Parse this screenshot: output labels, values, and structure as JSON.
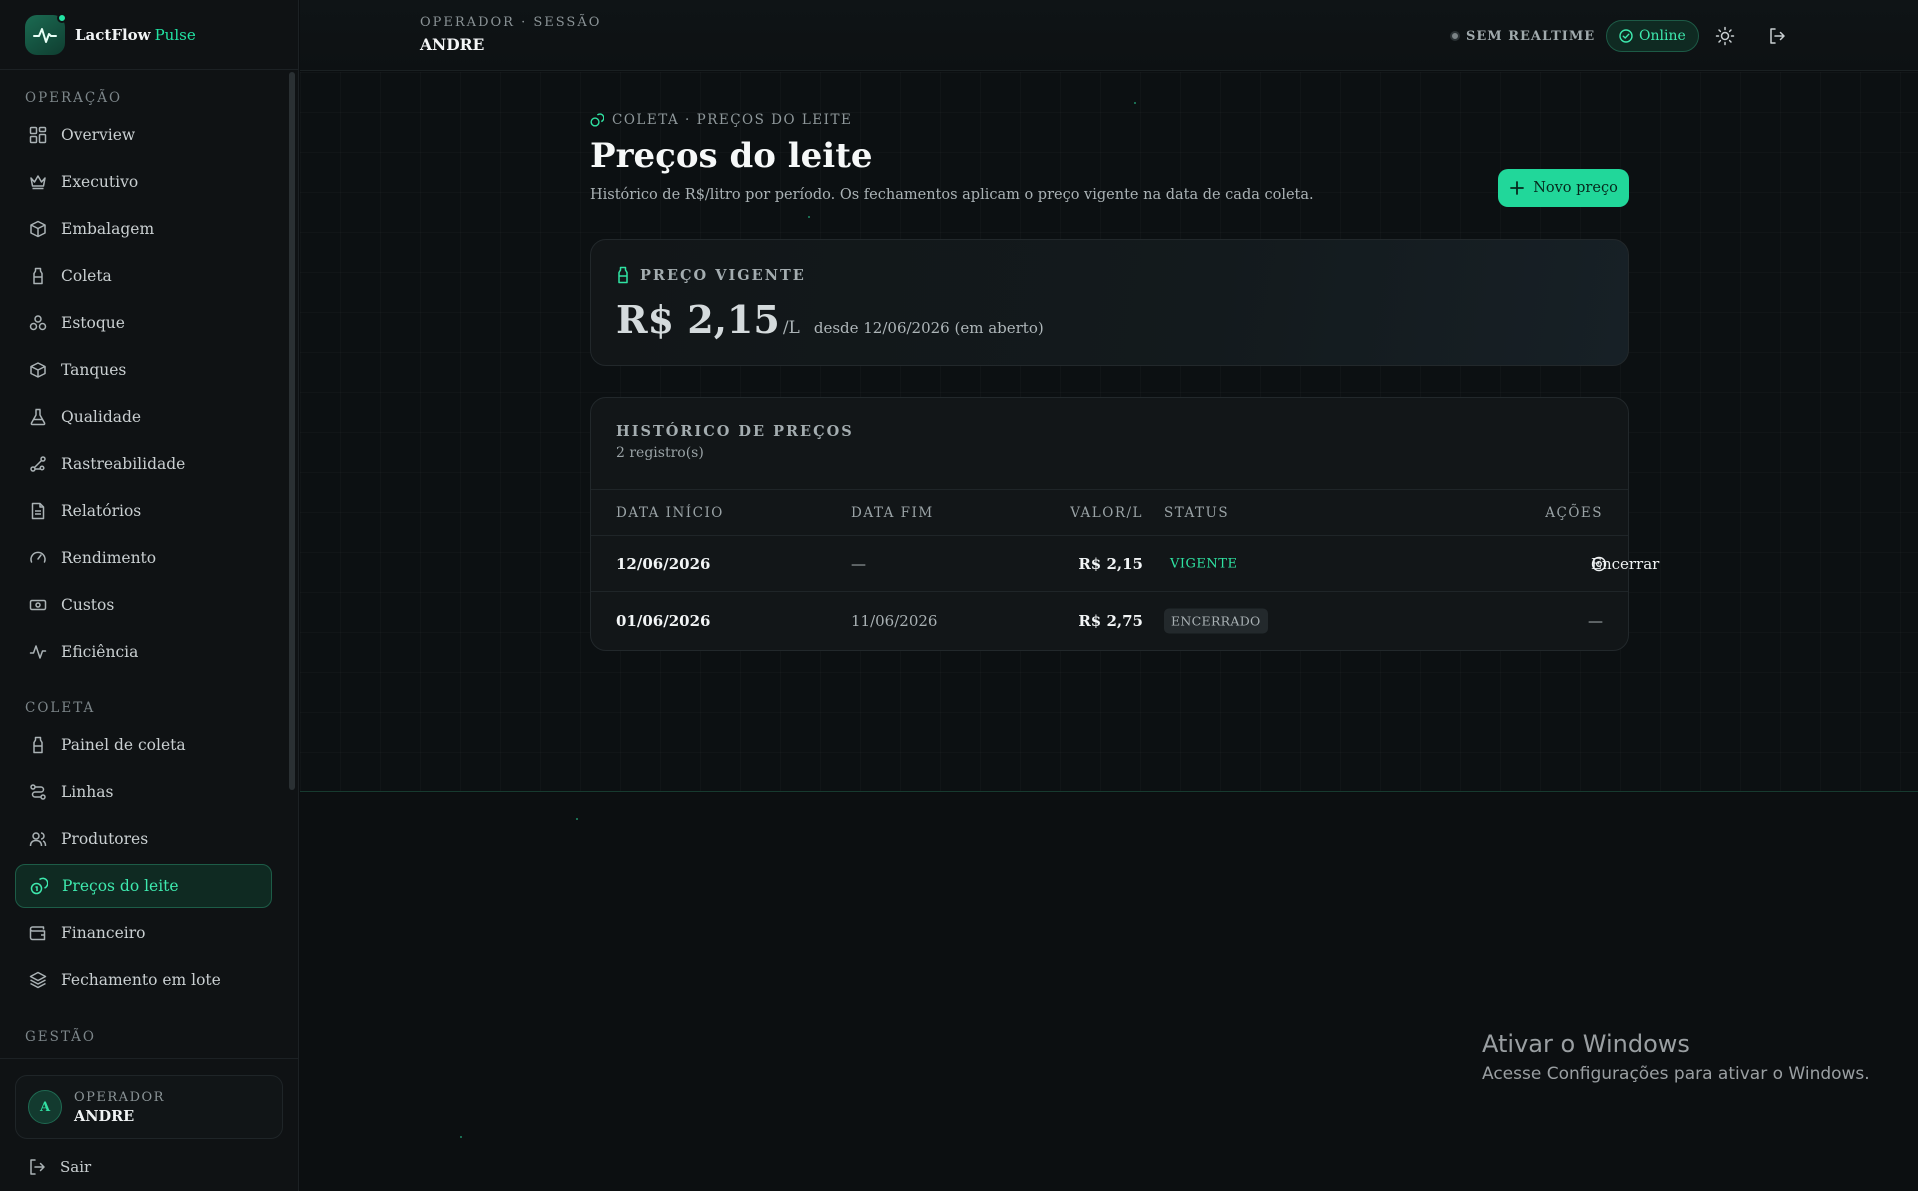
{
  "brand": {
    "name": "LactFlow",
    "accent": "Pulse"
  },
  "sidebar": {
    "sections": [
      {
        "label": "OPERAÇÃO"
      },
      {
        "label": "COLETA"
      },
      {
        "label": "GESTÃO"
      }
    ],
    "operacao": [
      {
        "label": "Overview",
        "icon": "grid-icon"
      },
      {
        "label": "Executivo",
        "icon": "crown-icon"
      },
      {
        "label": "Embalagem",
        "icon": "package-icon"
      },
      {
        "label": "Coleta",
        "icon": "milk-bottle-icon"
      },
      {
        "label": "Estoque",
        "icon": "boxes-icon"
      },
      {
        "label": "Tanques",
        "icon": "cube-icon"
      },
      {
        "label": "Qualidade",
        "icon": "flask-icon"
      },
      {
        "label": "Rastreabilidade",
        "icon": "route-icon"
      },
      {
        "label": "Relatórios",
        "icon": "document-icon"
      },
      {
        "label": "Rendimento",
        "icon": "gauge-icon"
      },
      {
        "label": "Custos",
        "icon": "banknote-icon"
      },
      {
        "label": "Eficiência",
        "icon": "activity-icon"
      }
    ],
    "coleta": [
      {
        "label": "Painel de coleta",
        "icon": "milk-bottle-icon"
      },
      {
        "label": "Linhas",
        "icon": "route-lines-icon"
      },
      {
        "label": "Produtores",
        "icon": "users-icon"
      },
      {
        "label": "Preços do leite",
        "icon": "coins-icon",
        "active": true
      },
      {
        "label": "Financeiro",
        "icon": "wallet-icon"
      },
      {
        "label": "Fechamento em lote",
        "icon": "layers-icon"
      }
    ],
    "user": {
      "initial": "A",
      "role": "OPERADOR",
      "name": "ANDRE"
    },
    "logout_label": "Sair"
  },
  "topbar": {
    "session_label": "OPERADOR · SESSÃO",
    "session_user": "ANDRE",
    "realtime_label": "SEM REALTIME",
    "online_label": "Online"
  },
  "page": {
    "breadcrumb": "COLETA · PREÇOS DO LEITE",
    "title": "Preços do leite",
    "subtitle": "Histórico de R$/litro por período. Os fechamentos aplicam o preço vigente na data de cada coleta.",
    "new_button": "Novo preço"
  },
  "current_price": {
    "label": "PREÇO VIGENTE",
    "value": "R$ 2,15",
    "unit": "/L",
    "since": "desde 12/06/2026 (em aberto)"
  },
  "history": {
    "title": "HISTÓRICO DE PREÇOS",
    "count": "2 registro(s)",
    "columns": [
      "DATA INÍCIO",
      "DATA FIM",
      "VALOR/L",
      "STATUS",
      "AÇÕES"
    ],
    "rows": [
      {
        "start": "12/06/2026",
        "end": "—",
        "value": "R$ 2,15",
        "status": "VIGENTE",
        "action": "Encerrar"
      },
      {
        "start": "01/06/2026",
        "end": "11/06/2026",
        "value": "R$ 2,75",
        "status": "ENCERRADO",
        "action": "—"
      }
    ]
  },
  "watermark": {
    "title": "Ativar o Windows",
    "subtitle": "Acesse Configurações para ativar o Windows."
  },
  "colors": {
    "accent": "#22e3a3",
    "background": "#0b0e10",
    "card": "#121618"
  }
}
